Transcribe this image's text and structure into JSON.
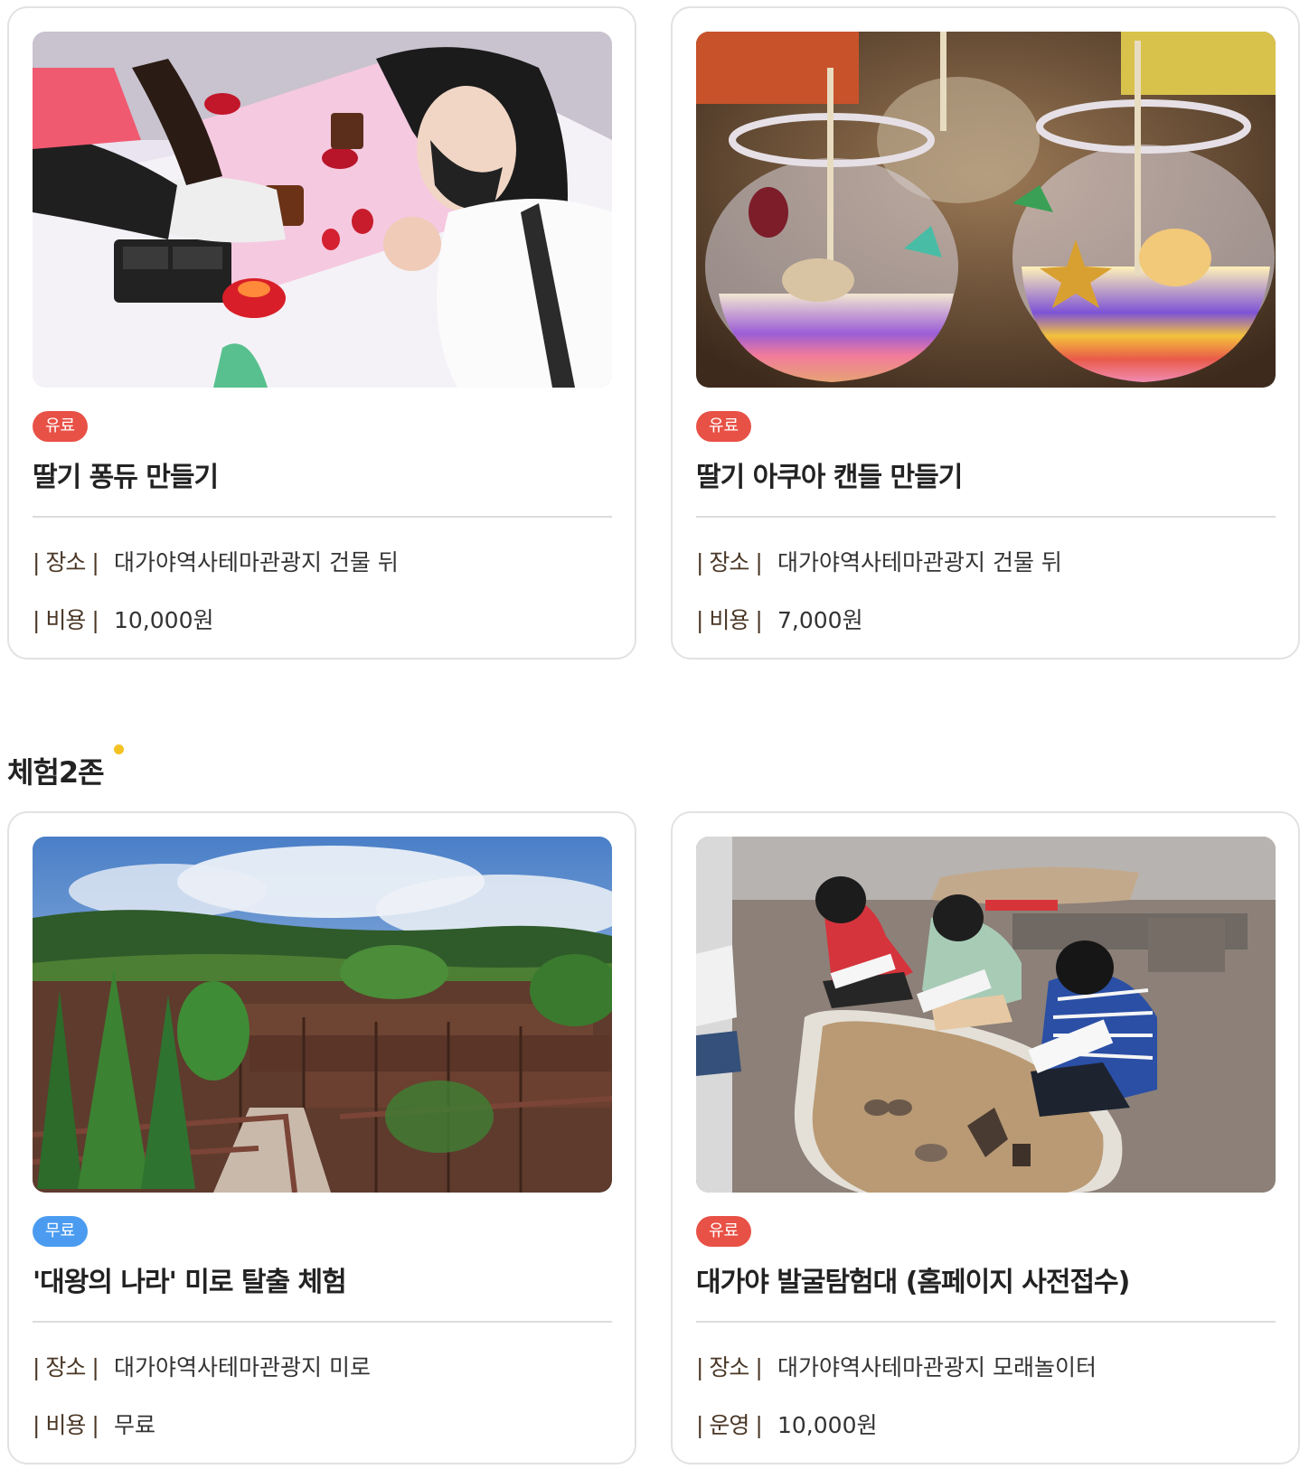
{
  "cards_top": [
    {
      "badge": "유료",
      "badge_type": "paid",
      "title": "딸기 퐁듀 만들기",
      "row1_label": "| 장소 |",
      "row1_value": "대가야역사테마관광지 건물 뒤",
      "row2_label": "| 비용 |",
      "row2_value": "10,000원",
      "photo_icon": "strawberry-fondue-photo"
    },
    {
      "badge": "유료",
      "badge_type": "paid",
      "title": "딸기 아쿠아 캔들 만들기",
      "row1_label": "| 장소 |",
      "row1_value": "대가야역사테마관광지 건물 뒤",
      "row2_label": "| 비용 |",
      "row2_value": "7,000원",
      "photo_icon": "aqua-candle-photo"
    }
  ],
  "zone": {
    "title": "체험2존"
  },
  "cards_bottom": [
    {
      "badge": "무료",
      "badge_type": "free",
      "title": "'대왕의 나라' 미로 탈출 체험",
      "row1_label": "| 장소 |",
      "row1_value": "대가야역사테마관광지 미로",
      "row2_label": "| 비용 |",
      "row2_value": "무료",
      "photo_icon": "maze-photo"
    },
    {
      "badge": "유료",
      "badge_type": "paid",
      "title": "대가야 발굴탐험대 (홈페이지 사전접수)",
      "row1_label": "| 장소 |",
      "row1_value": "대가야역사테마관광지 모래놀이터",
      "row2_label": "| 운영 |",
      "row2_value": "10,000원",
      "photo_icon": "excavation-photo"
    }
  ],
  "colors": {
    "paid_badge": "#e85146",
    "free_badge": "#4b9cf0",
    "zone_dot": "#f5c223"
  }
}
